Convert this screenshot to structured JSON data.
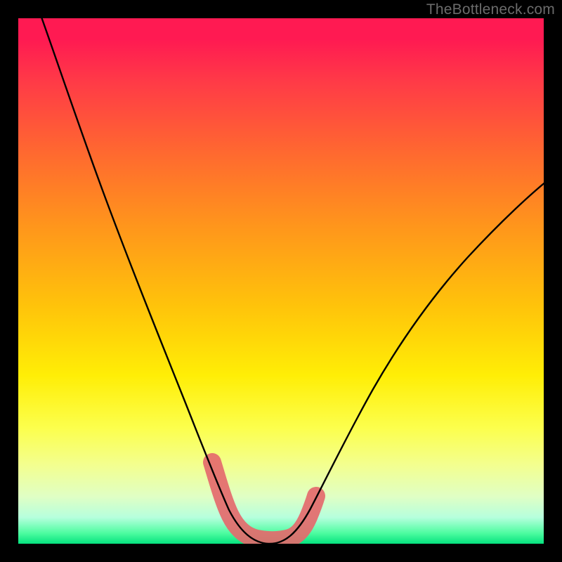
{
  "watermark": {
    "text": "TheBottleneck.com"
  },
  "chart_data": {
    "type": "line",
    "title": "",
    "xlabel": "",
    "ylabel": "",
    "xlim": [
      0,
      100
    ],
    "ylim": [
      0,
      100
    ],
    "grid": false,
    "legend": false,
    "background": "vertical-gradient red→yellow→green",
    "series": [
      {
        "name": "black-curve",
        "color": "#000000",
        "width": 2,
        "x": [
          5,
          8,
          12,
          16,
          20,
          24,
          28,
          32,
          36,
          38,
          40,
          42,
          44,
          46,
          48,
          50,
          54,
          58,
          62,
          66,
          70,
          75,
          80,
          85,
          90,
          95,
          98
        ],
        "values": [
          100,
          93,
          84,
          75,
          66,
          57,
          48,
          39,
          29,
          23,
          17,
          12,
          8,
          5,
          3,
          3,
          5,
          9,
          14,
          20,
          26,
          33,
          40,
          47,
          53,
          59,
          63
        ]
      },
      {
        "name": "pink-highlight",
        "color": "#e46a6d",
        "width": 16,
        "x": [
          37,
          38,
          40,
          42,
          44,
          46,
          48,
          50,
          52,
          54,
          55
        ],
        "values": [
          15,
          12,
          7,
          4,
          2,
          1,
          1,
          1,
          2,
          5,
          8
        ]
      }
    ],
    "notes": "Values are percentage estimates read visually from the plot area; the chart has no axes, ticks, or labels. The curve depicts a V-shaped dip reaching ≈0 near x≈47 with a shallower rise on the right side. A thick semi-transparent pink stroke overlays the trough region."
  }
}
